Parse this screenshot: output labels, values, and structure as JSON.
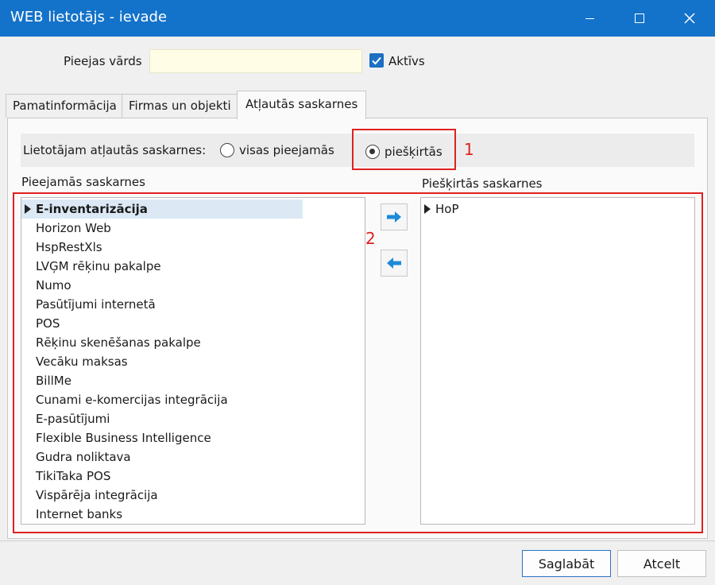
{
  "window": {
    "title": "WEB lietotājs - ievade",
    "title_bar_color": "#1372c9"
  },
  "form": {
    "login_label": "Pieejas vārds",
    "login_value": "",
    "active_label": "Aktīvs",
    "active_checked": true
  },
  "tabs": [
    "Pamatinformācija",
    "Firmas un objekti",
    "Atļautās saskarnes"
  ],
  "active_tab": "Atļautās saskarnes",
  "permissions": {
    "question_label": "Lietotājam atļautās saskarnes:",
    "option_all": "visas pieejamās",
    "option_assigned": "piešķirtās",
    "selected_option": "piešķirtās"
  },
  "annotations": {
    "marker_1": "1",
    "marker_2": "2",
    "color": "#e02020"
  },
  "available": {
    "title": "Pieejamās saskarnes",
    "items": [
      "E-inventarizācija",
      "Horizon Web",
      "HspRestXls",
      "LVĢM rēķinu pakalpe",
      "Numo",
      "Pasūtījumi internetā",
      "POS",
      "Rēķinu skenēšanas pakalpe",
      "Vecāku maksas",
      "BillMe",
      "Cunami e-komercijas integrācija",
      "E-pasūtījumi",
      "Flexible Business Intelligence",
      "Gudra noliktava",
      "TikiTaka POS",
      "Vispārēja integrācija",
      "Internet banks"
    ],
    "selected_item": "E-inventarizācija"
  },
  "assigned": {
    "title": "Piešķirtās saskarnes",
    "items": [
      "HoP"
    ]
  },
  "buttons": {
    "save": "Saglabāt",
    "cancel": "Atcelt"
  }
}
